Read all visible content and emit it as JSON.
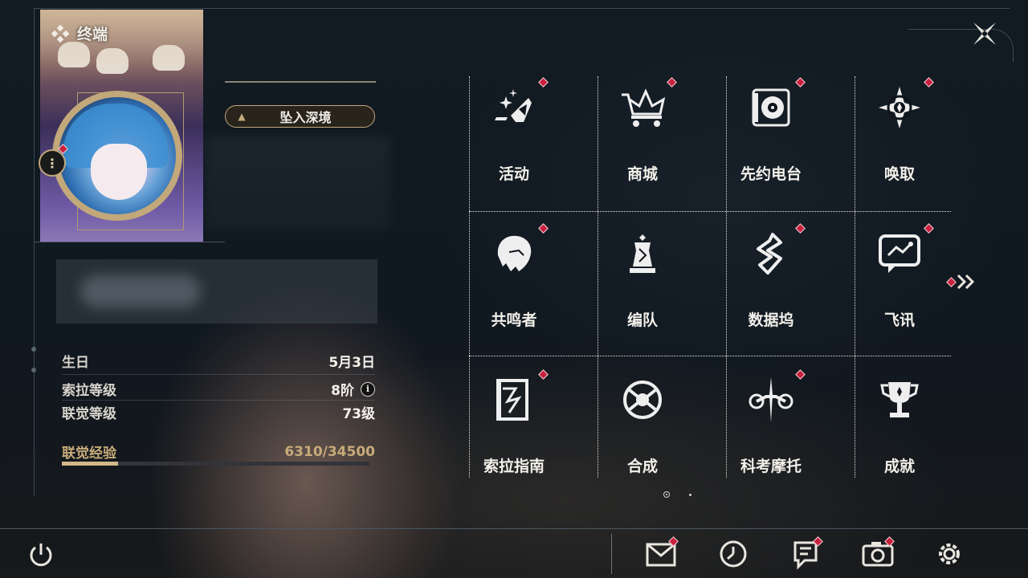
{
  "header": {
    "title": "终端"
  },
  "profile": {
    "action_button": "坠入深境",
    "stats": [
      {
        "key": "生日",
        "value": "5月3日"
      },
      {
        "key": "索拉等级",
        "value": "8阶"
      },
      {
        "key": "联觉等级",
        "value": "73级"
      }
    ],
    "exp": {
      "label": "联觉经验",
      "value": "6310/34500",
      "current": 6310,
      "max": 34500
    }
  },
  "menu": {
    "items": [
      {
        "label": "活动",
        "icon": "sparkle-icon",
        "badge": true
      },
      {
        "label": "商城",
        "icon": "crown-cart-icon",
        "badge": true
      },
      {
        "label": "先约电台",
        "icon": "record-player-icon",
        "badge": true
      },
      {
        "label": "唤取",
        "icon": "compass-star-icon",
        "badge": true
      },
      {
        "label": "共鸣者",
        "icon": "character-head-icon",
        "badge": true
      },
      {
        "label": "编队",
        "icon": "chess-piece-icon",
        "badge": false
      },
      {
        "label": "数据坞",
        "icon": "data-dock-icon",
        "badge": true
      },
      {
        "label": "飞讯",
        "icon": "message-bubble-icon",
        "badge": true
      },
      {
        "label": "索拉指南",
        "icon": "guide-book-icon",
        "badge": true
      },
      {
        "label": "合成",
        "icon": "synthesis-icon",
        "badge": false
      },
      {
        "label": "科考摩托",
        "icon": "motorcycle-icon",
        "badge": true
      },
      {
        "label": "成就",
        "icon": "trophy-icon",
        "badge": false
      }
    ],
    "page": 1,
    "page_count": 2
  },
  "bottom_bar": [
    {
      "icon": "mail-icon",
      "badge": true
    },
    {
      "icon": "clock-icon",
      "badge": false
    },
    {
      "icon": "notice-icon",
      "badge": true
    },
    {
      "icon": "camera-icon",
      "badge": true
    },
    {
      "icon": "gear-icon",
      "badge": false
    }
  ],
  "colors": {
    "accent": "#c2a87a",
    "badge": "#c8203d",
    "text": "#f3f0ea"
  }
}
